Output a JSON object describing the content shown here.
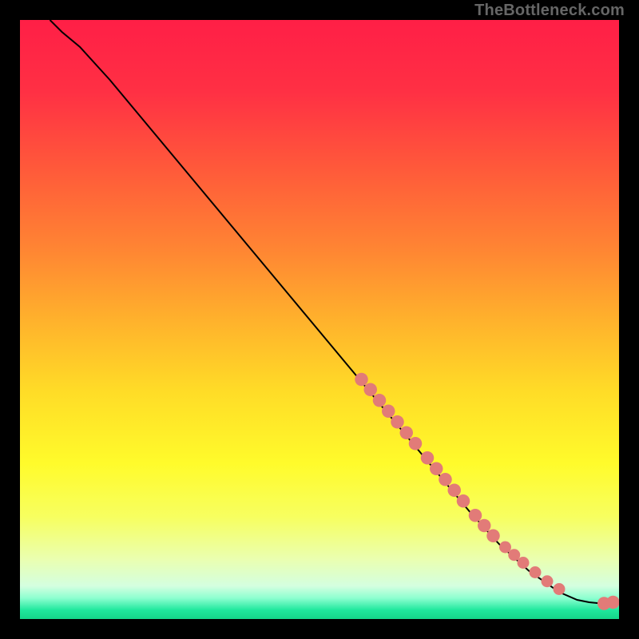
{
  "attribution": "TheBottleneck.com",
  "gradient": {
    "stops": [
      {
        "offset": 0.0,
        "color": "#ff1f46"
      },
      {
        "offset": 0.12,
        "color": "#ff3044"
      },
      {
        "offset": 0.25,
        "color": "#ff5a3a"
      },
      {
        "offset": 0.38,
        "color": "#ff8433"
      },
      {
        "offset": 0.5,
        "color": "#ffb12c"
      },
      {
        "offset": 0.62,
        "color": "#ffdc27"
      },
      {
        "offset": 0.74,
        "color": "#fffb2b"
      },
      {
        "offset": 0.83,
        "color": "#f7ff60"
      },
      {
        "offset": 0.9,
        "color": "#eaffb0"
      },
      {
        "offset": 0.945,
        "color": "#d4ffe0"
      },
      {
        "offset": 0.965,
        "color": "#8dffd0"
      },
      {
        "offset": 0.985,
        "color": "#20e89d"
      },
      {
        "offset": 1.0,
        "color": "#15d689"
      }
    ]
  },
  "chart_data": {
    "type": "line",
    "title": "",
    "xlabel": "",
    "ylabel": "",
    "xlim": [
      0,
      100
    ],
    "ylim": [
      0,
      100
    ],
    "grid": false,
    "legend": false,
    "curve": [
      {
        "x": 5,
        "y": 100
      },
      {
        "x": 7,
        "y": 98
      },
      {
        "x": 10,
        "y": 95.5
      },
      {
        "x": 15,
        "y": 90
      },
      {
        "x": 20,
        "y": 84
      },
      {
        "x": 25,
        "y": 78
      },
      {
        "x": 30,
        "y": 72
      },
      {
        "x": 35,
        "y": 66
      },
      {
        "x": 40,
        "y": 60
      },
      {
        "x": 45,
        "y": 54
      },
      {
        "x": 50,
        "y": 48
      },
      {
        "x": 55,
        "y": 42
      },
      {
        "x": 60,
        "y": 36
      },
      {
        "x": 65,
        "y": 30
      },
      {
        "x": 70,
        "y": 24
      },
      {
        "x": 75,
        "y": 18
      },
      {
        "x": 80,
        "y": 12.5
      },
      {
        "x": 85,
        "y": 8
      },
      {
        "x": 90,
        "y": 4.5
      },
      {
        "x": 93,
        "y": 3.2
      },
      {
        "x": 95,
        "y": 2.8
      },
      {
        "x": 97,
        "y": 2.6
      },
      {
        "x": 98,
        "y": 2.6
      },
      {
        "x": 99,
        "y": 2.8
      }
    ],
    "markers": [
      {
        "x": 57.0,
        "y": 40.0,
        "r": 1.1
      },
      {
        "x": 58.5,
        "y": 38.3,
        "r": 1.1
      },
      {
        "x": 60.0,
        "y": 36.5,
        "r": 1.1
      },
      {
        "x": 61.5,
        "y": 34.7,
        "r": 1.1
      },
      {
        "x": 63.0,
        "y": 32.9,
        "r": 1.1
      },
      {
        "x": 64.5,
        "y": 31.1,
        "r": 1.1
      },
      {
        "x": 66.0,
        "y": 29.3,
        "r": 1.1
      },
      {
        "x": 68.0,
        "y": 26.9,
        "r": 1.1
      },
      {
        "x": 69.5,
        "y": 25.1,
        "r": 1.1
      },
      {
        "x": 71.0,
        "y": 23.3,
        "r": 1.1
      },
      {
        "x": 72.5,
        "y": 21.5,
        "r": 1.1
      },
      {
        "x": 74.0,
        "y": 19.7,
        "r": 1.1
      },
      {
        "x": 76.0,
        "y": 17.3,
        "r": 1.1
      },
      {
        "x": 77.5,
        "y": 15.6,
        "r": 1.1
      },
      {
        "x": 79.0,
        "y": 13.9,
        "r": 1.1
      },
      {
        "x": 81.0,
        "y": 12.0,
        "r": 1.0
      },
      {
        "x": 82.5,
        "y": 10.7,
        "r": 1.0
      },
      {
        "x": 84.0,
        "y": 9.4,
        "r": 1.0
      },
      {
        "x": 86.0,
        "y": 7.8,
        "r": 1.0
      },
      {
        "x": 88.0,
        "y": 6.3,
        "r": 1.0
      },
      {
        "x": 90.0,
        "y": 5.0,
        "r": 1.0
      },
      {
        "x": 97.5,
        "y": 2.6,
        "r": 1.1
      },
      {
        "x": 99.0,
        "y": 2.8,
        "r": 1.1
      }
    ],
    "marker_color": "#e27b78",
    "curve_color": "#000000"
  }
}
